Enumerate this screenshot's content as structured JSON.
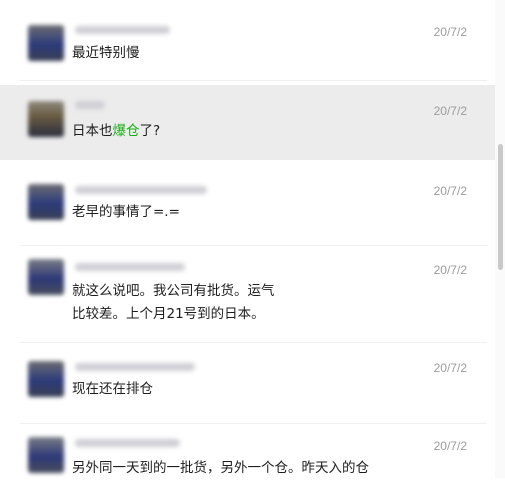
{
  "messages": [
    {
      "date": "20/7/2",
      "text": "最近特别慢"
    },
    {
      "date": "20/7/2",
      "text_before": "日本也",
      "keyword": "爆仓",
      "text_after": "了?"
    },
    {
      "date": "20/7/2",
      "text": "老早的事情了=.="
    },
    {
      "date": "20/7/2",
      "text": "就这么说吧。我公司有批货。运气比较差。上个月21号到的日本。"
    },
    {
      "date": "20/7/2",
      "text": "现在还在排仓"
    },
    {
      "date": "20/7/2",
      "text": "另外同一天到的一批货，另外一个仓。昨天入的仓"
    }
  ],
  "colors": {
    "keyword": "#1aad19",
    "highlight": "#ececec",
    "date": "#9c9c9c"
  }
}
